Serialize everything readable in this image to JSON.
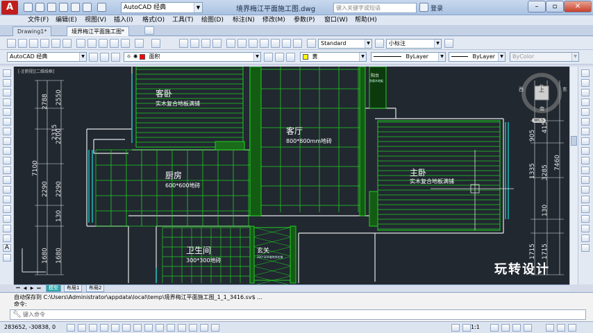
{
  "window": {
    "logo": "A",
    "workspace": "AutoCAD 经典",
    "title": "境界梅江平面施工图.dwg",
    "search_placeholder": "键入关键字或短语",
    "login": "登录",
    "min_glyph": "–",
    "max_glyph": "▫",
    "close_glyph": "✕"
  },
  "menu": [
    "文件(F)",
    "编辑(E)",
    "视图(V)",
    "插入(I)",
    "格式(O)",
    "工具(T)",
    "绘图(D)",
    "标注(N)",
    "修改(M)",
    "参数(P)",
    "窗口(W)",
    "帮助(H)"
  ],
  "doc_tabs": [
    "Drawing1*",
    "境界梅江平面施工图*"
  ],
  "toolbar2": {
    "text_style": "Standard",
    "dim_style": "小标注"
  },
  "toolbar3": {
    "workspace": "AutoCAD 经典",
    "layer": "面积",
    "color": "黄",
    "linetype": "ByLayer",
    "lineweight": "ByLayer",
    "plotstyle": "ByColor",
    "layer_color": "#ff0000",
    "color_swatch": "#ffff00"
  },
  "viewport_label": "[-][俯视][二维线框]",
  "rooms": [
    {
      "name": "客卧",
      "note": "实木复合地板满铺"
    },
    {
      "name": "客厅",
      "note": "800*800mm地砖"
    },
    {
      "name": "主卧",
      "note": "实木复合地板满铺"
    },
    {
      "name": "厨房",
      "note": "600*600地砖"
    },
    {
      "name": "卫生间",
      "note": "300*300地砖"
    },
    {
      "name": "玄关",
      "note": "300*300地砖拼花铺"
    },
    {
      "name": "阳台",
      "note": "防腐木地板"
    }
  ],
  "dims_left": [
    "2788",
    "2550",
    "2315",
    "2200",
    "7100",
    "2290",
    "2290",
    "130",
    "1680",
    "1680"
  ],
  "dims_right": [
    "905",
    "415",
    "1335",
    "3285",
    "7460",
    "130",
    "1715",
    "1715"
  ],
  "compass": {
    "north": "北",
    "south": "南",
    "east": "东",
    "west": "西",
    "top": "上",
    "wcs": "WCS"
  },
  "watermark": "玩转设计",
  "layout_tabs": [
    "模型",
    "布局1",
    "布局2"
  ],
  "command": {
    "line1": "自动保存到 C:\\Users\\Administrator\\appdata\\local\\temp\\境界梅江平面施工图_1_1_3416.sv$ ...",
    "line2": "命令:",
    "placeholder": "键入命令"
  },
  "status": {
    "coords": "283652, -30838, 0",
    "scale": "1:1"
  }
}
